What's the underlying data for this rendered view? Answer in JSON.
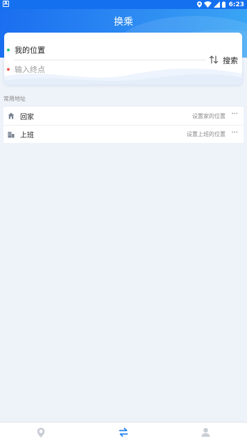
{
  "status_bar": {
    "left_badge": "A",
    "time": "6:23"
  },
  "header": {
    "title": "换乘"
  },
  "route_card": {
    "origin": "我的位置",
    "destination_placeholder": "输入终点",
    "destination_value": "",
    "search_label": "搜索"
  },
  "common_addresses": {
    "section_label": "常用地址",
    "items": [
      {
        "name": "回家",
        "hint": "设置家的位置",
        "more": "···",
        "icon": "home-icon"
      },
      {
        "name": "上班",
        "hint": "设置上班的位置",
        "more": "···",
        "icon": "office-icon"
      }
    ]
  },
  "tab_bar": {
    "tabs": [
      {
        "id": "map",
        "icon": "location-pin-icon",
        "active": false
      },
      {
        "id": "transfer",
        "icon": "transfer-arrows-icon",
        "active": true
      },
      {
        "id": "profile",
        "icon": "user-icon",
        "active": false
      }
    ]
  },
  "colors": {
    "brand_blue": "#1570f0",
    "active_tab": "#1a7ef2",
    "inactive_tab": "#c9cdd4",
    "origin_dot": "#23c27a",
    "destination_dot": "#f05a5a"
  }
}
